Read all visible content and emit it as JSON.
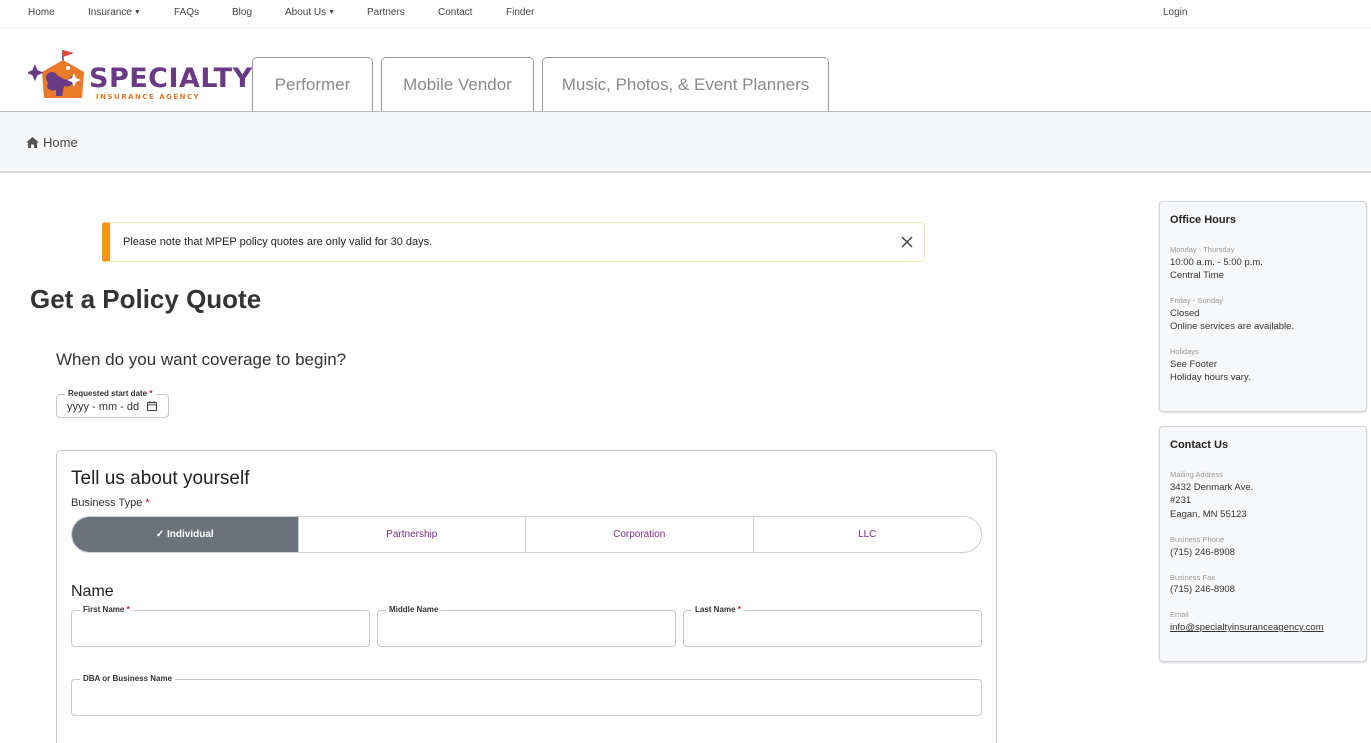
{
  "nav": {
    "home": "Home",
    "insurance": "Insurance",
    "faqs": "FAQs",
    "blog": "Blog",
    "about": "About Us",
    "partners": "Partners",
    "contact": "Contact",
    "finder": "Finder",
    "login": "Login"
  },
  "logo": {
    "name": "SPECIALTY",
    "sub": "INSURANCE AGENCY"
  },
  "tabs": [
    "Performer",
    "Mobile Vendor",
    "Music, Photos, & Event Planners"
  ],
  "breadcrumb": {
    "home": "Home"
  },
  "alert": {
    "text": "Please note that MPEP policy quotes are only valid for 30 days."
  },
  "page_title": "Get a Policy Quote",
  "coverage": {
    "question": "When do you want coverage to begin?",
    "start_label": "Requested start date",
    "start_placeholder": "yyyy - mm - dd",
    "required_mark": "*"
  },
  "about": {
    "title": "Tell us about yourself",
    "business_type_label": "Business Type",
    "business_types": [
      "✓ Individual",
      "Partnership",
      "Corporation",
      "LLC"
    ],
    "name_heading": "Name",
    "first_name": "First Name",
    "middle_name": "Middle Name",
    "last_name": "Last Name",
    "dba": "DBA or Business Name"
  },
  "office_hours": {
    "title": "Office Hours",
    "l1": "Monday - Thursday",
    "v1a": "10:00 a.m. - 5:00 p.m.",
    "v1b": "Central Time",
    "l2": "Friday - Sunday",
    "v2a": "Closed",
    "v2b": "Online services are available.",
    "l3": "Holidays",
    "v3a": "See Footer",
    "v3b": "Holiday hours vary."
  },
  "contact": {
    "title": "Contact Us",
    "l1": "Mailing Address",
    "addr1": "3432 Denmark Ave.",
    "addr2": "#231",
    "addr3": "Eagan, MN 55123",
    "l2": "Business Phone",
    "phone": "(715) 246-8908",
    "l3": "Business Fax",
    "fax": "(715) 246-8908",
    "l4": "Email",
    "email": "info@specialtyinsuranceagency.com"
  },
  "colors": {
    "brand_purple": "#6a3a86",
    "brand_orange": "#e87a2a",
    "alert_accent": "#f7941d",
    "required": "#d01010",
    "segment_active": "#6c727a"
  },
  "icons": {
    "breadcrumb": "home-icon",
    "alert": "close-icon",
    "date": "calendar-icon",
    "nav_dropdown": "caret-down-icon"
  }
}
